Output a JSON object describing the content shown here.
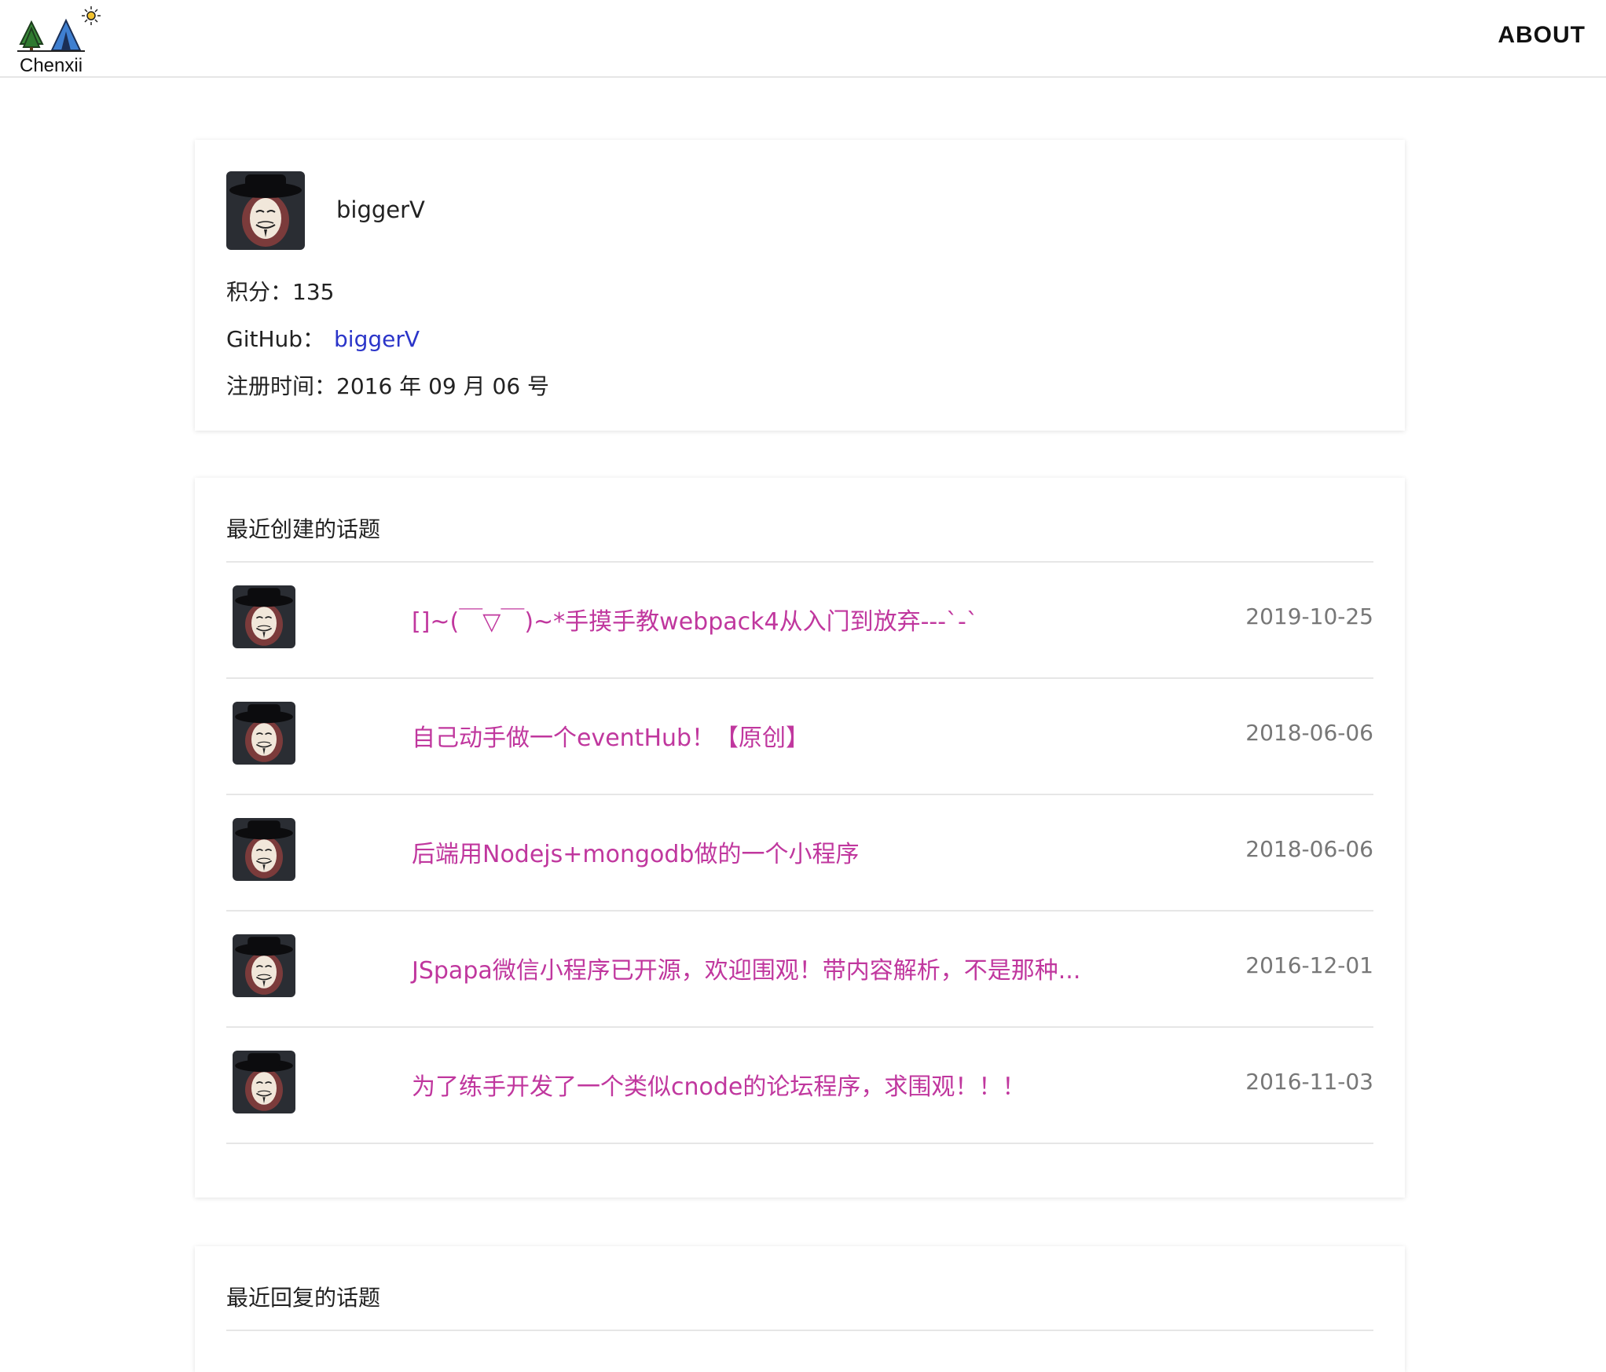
{
  "header": {
    "logo_text": "Chenxii",
    "about_label": "ABOUT"
  },
  "profile": {
    "username": "biggerV",
    "score_label": "积分：",
    "score_value": "135",
    "github_label": "GitHub：",
    "github_link": "biggerV",
    "register_label": "注册时间：",
    "register_value": "2016 年 09 月 06 号"
  },
  "recent_created": {
    "title": "最近创建的话题",
    "items": [
      {
        "title": "[]~(￣▽￣)~*手摸手教webpack4从入门到放弃---`-`",
        "date": "2019-10-25"
      },
      {
        "title": "自己动手做一个eventHub！【原创】",
        "date": "2018-06-06"
      },
      {
        "title": "后端用Nodejs+mongodb做的一个小程序",
        "date": "2018-06-06"
      },
      {
        "title": "JSpapa微信小程序已开源，欢迎围观！带内容解析，不是那种...",
        "date": "2016-12-01"
      },
      {
        "title": "为了练手开发了一个类似cnode的论坛程序，求围观！！！",
        "date": "2016-11-03"
      }
    ]
  },
  "recent_replied": {
    "title": "最近回复的话题"
  },
  "colors": {
    "link_blue": "#2b35c9",
    "topic_magenta": "#c0379e",
    "date_gray": "#777777"
  },
  "icons": {
    "logo": "tree-tent-sun-logo-icon",
    "avatar": "guy-fawkes-mask-avatar"
  }
}
